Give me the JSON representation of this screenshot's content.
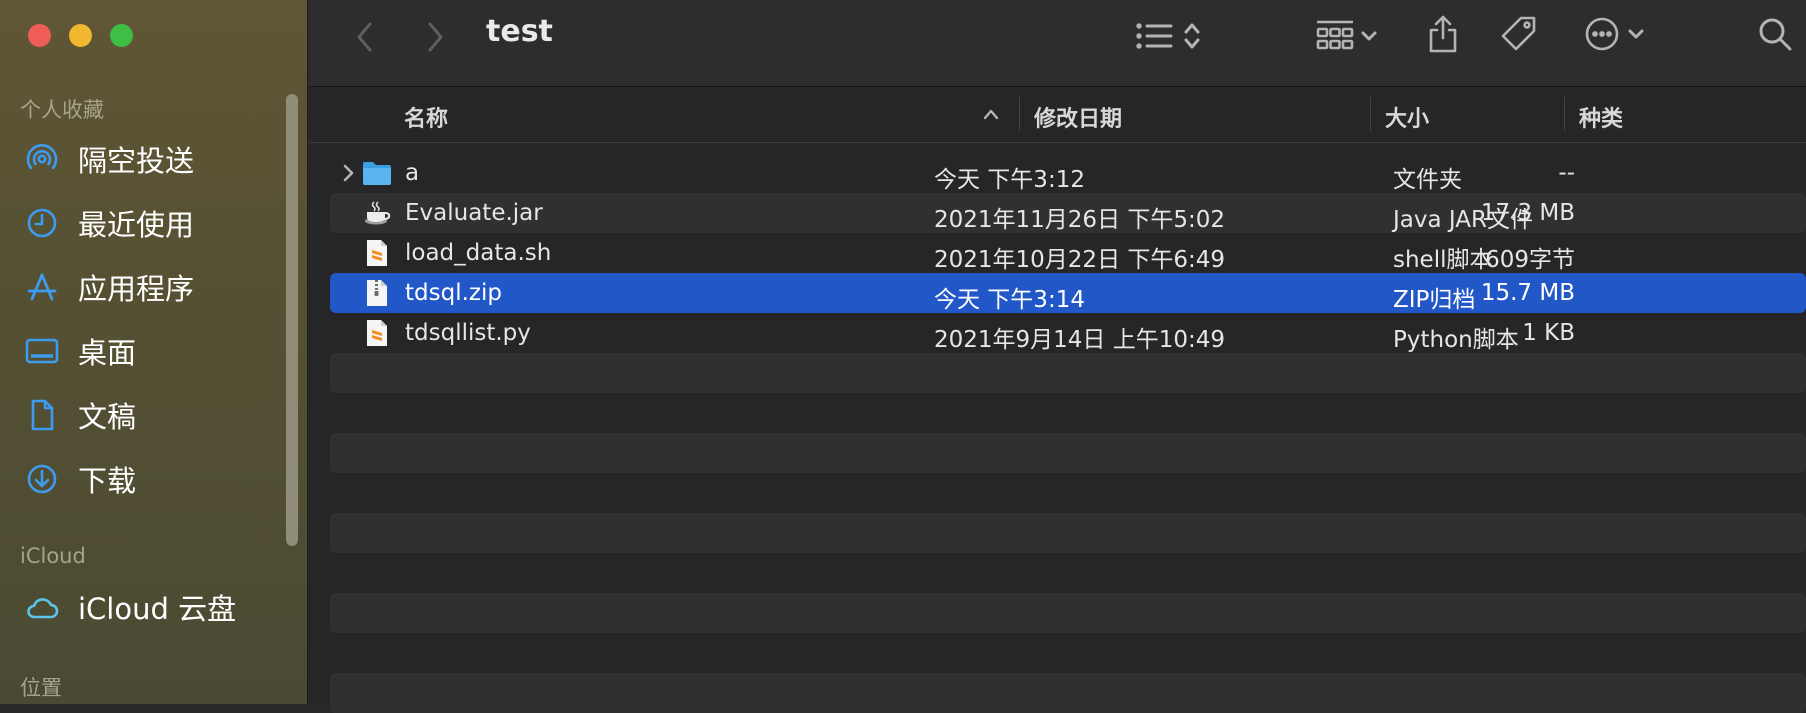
{
  "window": {
    "title": "test"
  },
  "sidebar": {
    "favorites_title": "个人收藏",
    "favorites": [
      {
        "label": "隔空投送",
        "icon": "airdrop-icon"
      },
      {
        "label": "最近使用",
        "icon": "clock-icon"
      },
      {
        "label": "应用程序",
        "icon": "applications-icon"
      },
      {
        "label": "桌面",
        "icon": "desktop-icon"
      },
      {
        "label": "文稿",
        "icon": "document-icon"
      },
      {
        "label": "下载",
        "icon": "download-icon"
      }
    ],
    "icloud_title": "iCloud",
    "icloud": [
      {
        "label": "iCloud 云盘",
        "icon": "cloud-icon"
      }
    ],
    "locations_title": "位置"
  },
  "columns": {
    "name": "名称",
    "date": "修改日期",
    "size": "大小",
    "kind": "种类"
  },
  "files": [
    {
      "name": "a",
      "date": "今天 下午3:12",
      "size": "--",
      "kind": "文件夹",
      "icon": "folder-icon",
      "expandable": true,
      "selected": false
    },
    {
      "name": "Evaluate.jar",
      "date": "2021年11月26日 下午5:02",
      "size": "17.3 MB",
      "kind": "Java JAR文件",
      "icon": "java-jar-icon",
      "expandable": false,
      "selected": false
    },
    {
      "name": "load_data.sh",
      "date": "2021年10月22日 下午6:49",
      "size": "609字节",
      "kind": "shell脚本",
      "icon": "sublime-script-icon",
      "expandable": false,
      "selected": false
    },
    {
      "name": "tdsql.zip",
      "date": "今天 下午3:14",
      "size": "15.7 MB",
      "kind": "ZIP归档",
      "icon": "zip-archive-icon",
      "expandable": false,
      "selected": true
    },
    {
      "name": "tdsqllist.py",
      "date": "2021年9月14日 上午10:49",
      "size": "1 KB",
      "kind": "Python脚本",
      "icon": "sublime-script-icon",
      "expandable": false,
      "selected": false
    }
  ],
  "colors": {
    "selection": "#2257c8",
    "accent": "#3d9cf0"
  }
}
